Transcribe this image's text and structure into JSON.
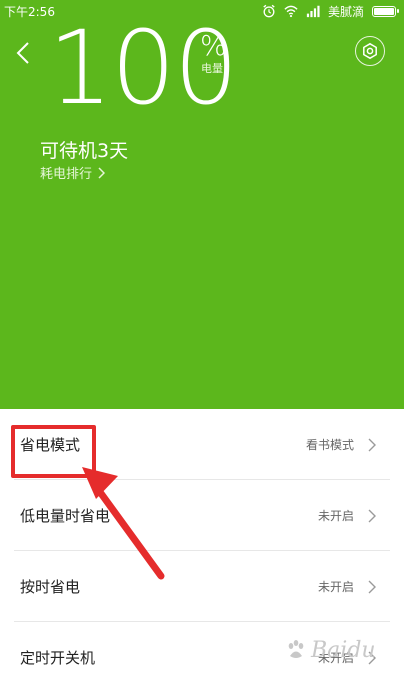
{
  "status_bar": {
    "time": "下午2:56",
    "carrier": "美腻滴",
    "battery_level": 1.0
  },
  "battery": {
    "percent": "100",
    "percent_sign": "%",
    "unit_label": "电量",
    "standby_text": "可待机3天",
    "ranking_link": "耗电排行"
  },
  "settings": [
    {
      "title": "省电模式",
      "value": "看书模式"
    },
    {
      "title": "低电量时省电",
      "value": "未开启"
    },
    {
      "title": "按时省电",
      "value": "未开启"
    },
    {
      "title": "定时开关机",
      "value": "未开启"
    }
  ],
  "icons": {
    "back": "chevron-left-icon",
    "settings": "settings-icon",
    "row_arrow": "chevron-right-icon"
  },
  "colors": {
    "hero_green": "#5cb71c",
    "annotation_red": "#e52c2c"
  },
  "watermark": {
    "text": "Baidu"
  }
}
